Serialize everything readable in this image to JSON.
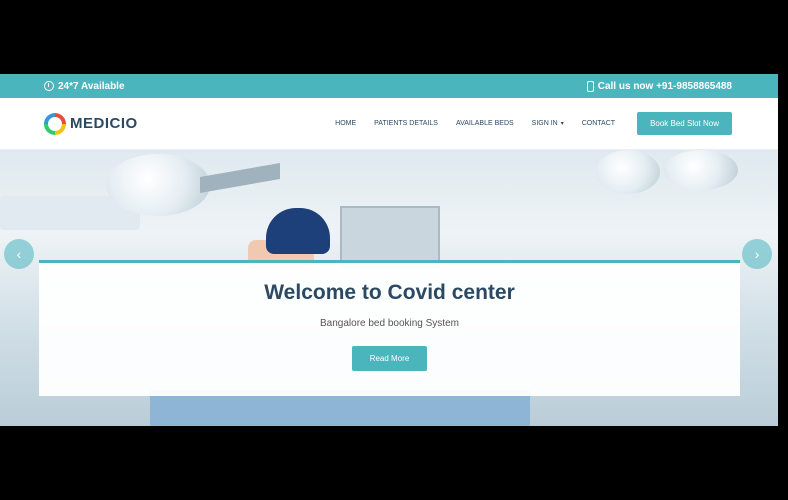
{
  "topbar": {
    "availability": "24*7 Available",
    "phone": "Call us now +91-9858865488"
  },
  "nav": {
    "logo": "MEDICIO",
    "items": [
      "HOME",
      "PATIENTS DETAILS",
      "AVAILABLE BEDS",
      "SIGN IN",
      "CONTACT"
    ],
    "cta": "Book Bed Slot Now"
  },
  "hero": {
    "title": "Welcome to Covid center",
    "subtitle": "Bangalore bed booking System",
    "button": "Read More"
  },
  "colors": {
    "accent": "#4bb5bd",
    "heading": "#2c4964"
  },
  "icons": {
    "topbar_left": "clock-icon",
    "topbar_right": "phone-icon",
    "slider_prev": "chevron-left-icon",
    "slider_next": "chevron-right-icon"
  }
}
